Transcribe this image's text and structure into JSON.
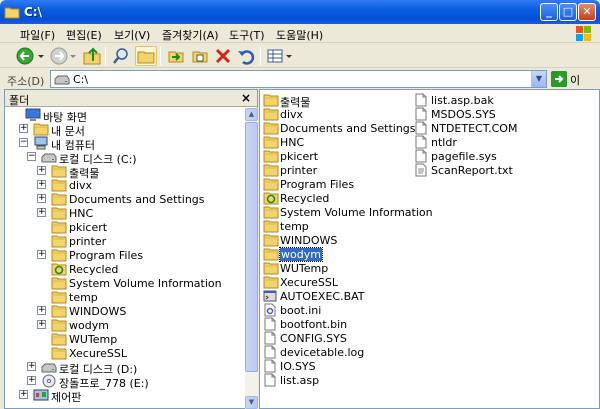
{
  "window": {
    "title": "C:\\"
  },
  "menu": [
    "파일(F)",
    "편집(E)",
    "보기(V)",
    "즐겨찾기(A)",
    "도구(T)",
    "도움말(H)"
  ],
  "address": {
    "label": "주소(D)",
    "value": "C:\\",
    "go_label": "이동"
  },
  "folders_pane": {
    "title": "폴더",
    "tree": [
      {
        "label": "바탕 화면",
        "icon": "desktop-icon",
        "expander": ""
      },
      {
        "label": "내 문서",
        "icon": "folder-icon",
        "expander": "+"
      },
      {
        "label": "내 컴퓨터",
        "icon": "computer-icon",
        "expander": "−"
      },
      {
        "label": "로컬 디스크 (C:)",
        "icon": "drive-icon",
        "expander": "−"
      },
      {
        "label": "출력물",
        "icon": "folder-icon",
        "expander": "+"
      },
      {
        "label": "divx",
        "icon": "folder-icon",
        "expander": "+"
      },
      {
        "label": "Documents and Settings",
        "icon": "folder-icon",
        "expander": "+"
      },
      {
        "label": "HNC",
        "icon": "folder-icon",
        "expander": "+"
      },
      {
        "label": "pkicert",
        "icon": "folder-icon",
        "expander": ""
      },
      {
        "label": "printer",
        "icon": "folder-icon",
        "expander": ""
      },
      {
        "label": "Program Files",
        "icon": "folder-icon",
        "expander": "+"
      },
      {
        "label": "Recycled",
        "icon": "recycle-icon",
        "expander": ""
      },
      {
        "label": "System Volume Information",
        "icon": "folder-icon",
        "expander": ""
      },
      {
        "label": "temp",
        "icon": "folder-icon",
        "expander": ""
      },
      {
        "label": "WINDOWS",
        "icon": "folder-icon",
        "expander": "+"
      },
      {
        "label": "wodym",
        "icon": "folder-icon",
        "expander": "+"
      },
      {
        "label": "WUTemp",
        "icon": "folder-icon",
        "expander": ""
      },
      {
        "label": "XecureSSL",
        "icon": "folder-icon",
        "expander": ""
      },
      {
        "label": "로컬 디스크 (D:)",
        "icon": "drive-icon",
        "expander": "+"
      },
      {
        "label": "장돌프로_778 (E:)",
        "icon": "cd-icon",
        "expander": "+"
      },
      {
        "label": "제어판",
        "icon": "control-panel-icon",
        "expander": "+"
      }
    ]
  },
  "files": [
    {
      "name": "출력물",
      "icon": "folder-icon"
    },
    {
      "name": "divx",
      "icon": "folder-icon"
    },
    {
      "name": "Documents and Settings",
      "icon": "folder-icon"
    },
    {
      "name": "HNC",
      "icon": "folder-icon"
    },
    {
      "name": "pkicert",
      "icon": "folder-icon"
    },
    {
      "name": "printer",
      "icon": "folder-icon"
    },
    {
      "name": "Program Files",
      "icon": "folder-icon"
    },
    {
      "name": "Recycled",
      "icon": "recycle-icon"
    },
    {
      "name": "System Volume Information",
      "icon": "folder-icon"
    },
    {
      "name": "temp",
      "icon": "folder-icon"
    },
    {
      "name": "WINDOWS",
      "icon": "folder-icon"
    },
    {
      "name": "wodym",
      "icon": "folder-icon",
      "selected": true
    },
    {
      "name": "WUTemp",
      "icon": "folder-icon"
    },
    {
      "name": "XecureSSL",
      "icon": "folder-icon"
    },
    {
      "name": "AUTOEXEC.BAT",
      "icon": "bat-file-icon"
    },
    {
      "name": "boot.ini",
      "icon": "ini-file-icon"
    },
    {
      "name": "bootfont.bin",
      "icon": "file-icon"
    },
    {
      "name": "CONFIG.SYS",
      "icon": "file-icon"
    },
    {
      "name": "devicetable.log",
      "icon": "file-icon"
    },
    {
      "name": "IO.SYS",
      "icon": "file-icon"
    },
    {
      "name": "list.asp",
      "icon": "file-icon"
    },
    {
      "name": "list.asp.bak",
      "icon": "file-icon"
    },
    {
      "name": "MSDOS.SYS",
      "icon": "file-icon"
    },
    {
      "name": "NTDETECT.COM",
      "icon": "file-icon"
    },
    {
      "name": "ntldr",
      "icon": "file-icon"
    },
    {
      "name": "pagefile.sys",
      "icon": "file-icon"
    },
    {
      "name": "ScanReport.txt",
      "icon": "txt-file-icon"
    }
  ],
  "colors": {
    "title_bar": "#0a5ce0",
    "selection": "#316ac5",
    "folder": "#f3d36b"
  }
}
